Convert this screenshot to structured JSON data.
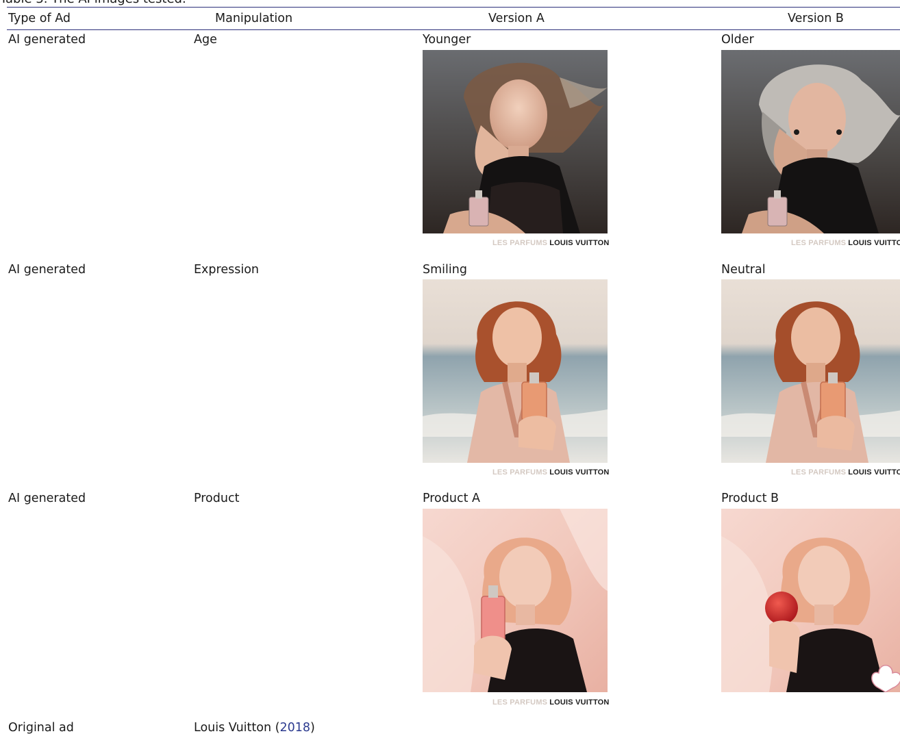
{
  "caption": "Table 3. The AI images tested.",
  "columns": {
    "type": "Type of Ad",
    "manipulation": "Manipulation",
    "version_a": "Version A",
    "version_b": "Version B"
  },
  "rows": [
    {
      "type": "AI generated",
      "manipulation": "Age",
      "version_a_label": "Younger",
      "version_b_label": "Older",
      "brand_light": "LES PARFUMS",
      "brand_dark": "LOUIS VUITTON",
      "brand_dark_b": "LOUIS VUITTO"
    },
    {
      "type": "AI generated",
      "manipulation": "Expression",
      "version_a_label": "Smiling",
      "version_b_label": "Neutral",
      "brand_light": "LES PARFUMS",
      "brand_dark": "LOUIS VUITTON",
      "brand_dark_b": "LOUIS VUITTO"
    },
    {
      "type": "AI generated",
      "manipulation": "Product",
      "version_a_label": "Product A",
      "version_b_label": "Product B",
      "brand_light": "LES PARFUMS",
      "brand_dark": "LOUIS VUITTON"
    }
  ],
  "original": {
    "type": "Original ad",
    "source_prefix": "Louis Vuitton (",
    "source_year": "2018",
    "source_suffix": ")"
  },
  "colors": {
    "rule": "#2b2f7a",
    "citation": "#2b3a8f"
  }
}
